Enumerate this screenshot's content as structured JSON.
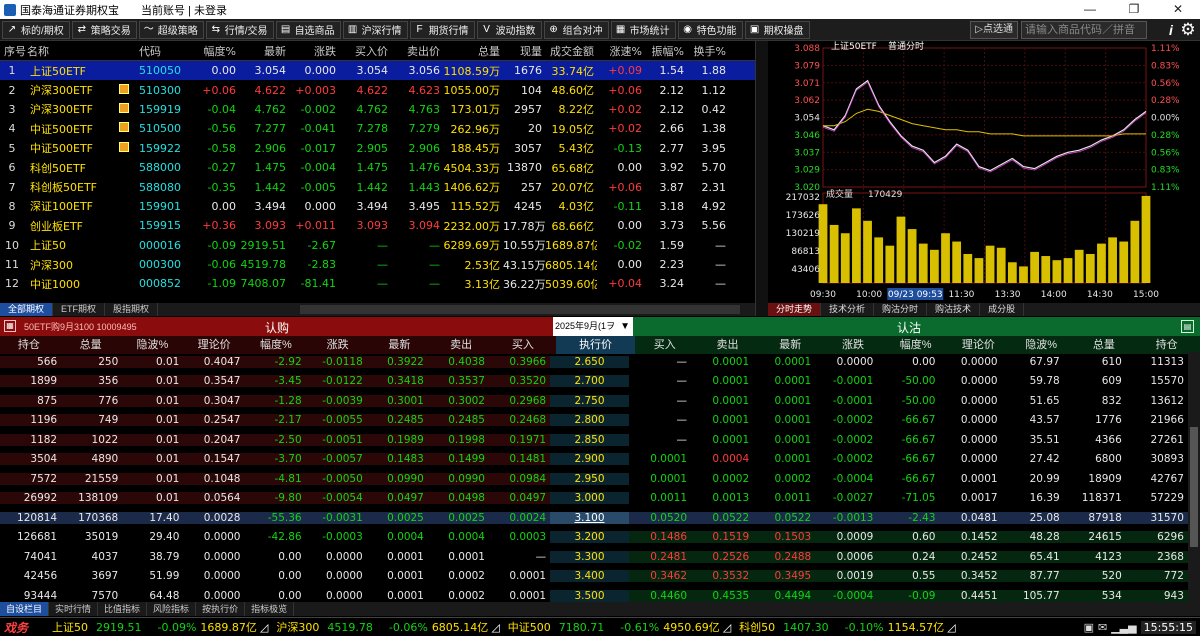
{
  "window": {
    "title": "国泰海通证券期权宝",
    "account": "当前账号 | 未登录",
    "min": "—",
    "max": "❐",
    "close": "✕"
  },
  "toolbar": {
    "buttons": [
      {
        "icon": "↗",
        "label": "标的/期权"
      },
      {
        "icon": "⇄",
        "label": "策略交易"
      },
      {
        "icon": "〜",
        "label": "超级策略"
      },
      {
        "icon": "⇆",
        "label": "行情/交易"
      },
      {
        "icon": "▤",
        "label": "自选商品"
      },
      {
        "icon": "▥",
        "label": "沪深行情"
      },
      {
        "icon": "F",
        "label": "期货行情"
      },
      {
        "icon": "V",
        "label": "波动指数"
      },
      {
        "icon": "⊕",
        "label": "组合对冲"
      },
      {
        "icon": "▦",
        "label": "市场统计"
      },
      {
        "icon": "◉",
        "label": "特色功能"
      },
      {
        "icon": "▣",
        "label": "期权操盘"
      }
    ],
    "send": "▷点选通",
    "search_placeholder": "请输入商品代码／拼音"
  },
  "quote": {
    "headers": [
      "序号",
      "名称",
      "",
      "代码",
      "幅度%",
      "最新",
      "涨跌",
      "买入价",
      "卖出价",
      "总量",
      "现量",
      "成交金额",
      "涨速%",
      "振幅%",
      "换手%"
    ],
    "rows": [
      [
        "1",
        "上证50ETF",
        "",
        "510050",
        "0.00",
        "3.054",
        "0.000",
        "3.054",
        "3.056",
        "1108.59万",
        "1676",
        "33.74亿",
        "+0.09",
        "1.54",
        "1.88"
      ],
      [
        "2",
        "沪深300ETF",
        "flag",
        "510300",
        "+0.06",
        "4.622",
        "+0.003",
        "4.622",
        "4.623",
        "1055.00万",
        "104",
        "48.60亿",
        "+0.06",
        "2.12",
        "1.12"
      ],
      [
        "3",
        "沪深300ETF",
        "flag",
        "159919",
        "-0.04",
        "4.762",
        "-0.002",
        "4.762",
        "4.763",
        "173.01万",
        "2957",
        "8.22亿",
        "+0.02",
        "2.12",
        "0.42"
      ],
      [
        "4",
        "中证500ETF",
        "flag",
        "510500",
        "-0.56",
        "7.277",
        "-0.041",
        "7.278",
        "7.279",
        "262.96万",
        "20",
        "19.05亿",
        "+0.02",
        "2.66",
        "1.38"
      ],
      [
        "5",
        "中证500ETF",
        "flag",
        "159922",
        "-0.58",
        "2.906",
        "-0.017",
        "2.905",
        "2.906",
        "188.45万",
        "3057",
        "5.43亿",
        "-0.13",
        "2.77",
        "3.95"
      ],
      [
        "6",
        "科创50ETF",
        "",
        "588000",
        "-0.27",
        "1.475",
        "-0.004",
        "1.475",
        "1.476",
        "4504.33万",
        "13870",
        "65.68亿",
        "0.00",
        "3.92",
        "5.70"
      ],
      [
        "7",
        "科创板50ETF",
        "",
        "588080",
        "-0.35",
        "1.442",
        "-0.005",
        "1.442",
        "1.443",
        "1406.62万",
        "257",
        "20.07亿",
        "+0.06",
        "3.87",
        "2.31"
      ],
      [
        "8",
        "深证100ETF",
        "",
        "159901",
        "0.00",
        "3.494",
        "0.000",
        "3.494",
        "3.495",
        "115.52万",
        "4245",
        "4.03亿",
        "-0.11",
        "3.18",
        "4.92"
      ],
      [
        "9",
        "创业板ETF",
        "",
        "159915",
        "+0.36",
        "3.093",
        "+0.011",
        "3.093",
        "3.094",
        "2232.00万",
        "17.78万",
        "68.66亿",
        "0.00",
        "3.73",
        "5.56"
      ],
      [
        "10",
        "上证50",
        "",
        "000016",
        "-0.09",
        "2919.51",
        "-2.67",
        "—",
        "—",
        "6289.69万",
        "10.55万",
        "1689.87亿",
        "-0.02",
        "1.59",
        "—"
      ],
      [
        "11",
        "沪深300",
        "",
        "000300",
        "-0.06",
        "4519.78",
        "-2.83",
        "—",
        "—",
        "2.53亿",
        "43.15万",
        "6805.14亿",
        "0.00",
        "2.23",
        "—"
      ],
      [
        "12",
        "中证1000",
        "",
        "000852",
        "-1.09",
        "7408.07",
        "-81.41",
        "—",
        "—",
        "3.13亿",
        "36.22万",
        "5039.60亿",
        "+0.04",
        "3.24",
        "—"
      ]
    ]
  },
  "quote_tabs": [
    "全部期权",
    "ETF期权",
    "股指期权"
  ],
  "chart": {
    "title": "上证50ETF",
    "mode": "普通分时",
    "y_labels": [
      "3.088",
      "3.079",
      "3.071",
      "3.062",
      "3.054",
      "3.046",
      "3.037",
      "3.029",
      "3.020"
    ],
    "pct_labels": [
      "1.11%",
      "0.83%",
      "0.56%",
      "0.28%",
      "0.00%",
      "0.28%",
      "0.56%",
      "0.83%",
      "1.11%"
    ],
    "vol_label": "成交量",
    "vol_value": "170429",
    "vol_y": [
      "217032",
      "173626",
      "130219",
      "86813",
      "43406"
    ],
    "x_labels": [
      "09:30",
      "10:00",
      "09/23 09:53",
      "11:30",
      "13:30",
      "14:00",
      "14:30",
      "15:00"
    ],
    "tabs": [
      "分时走势",
      "技术分析",
      "购沽分时",
      "购沽技术",
      "成分股"
    ],
    "chart_data": {
      "type": "line",
      "series": [
        {
          "values": [
            3.05,
            3.048,
            3.055,
            3.068,
            3.072,
            3.06,
            3.052,
            3.045,
            3.04,
            3.038,
            3.032,
            3.035,
            3.041,
            3.038,
            3.03,
            3.028,
            3.031,
            3.034,
            3.03,
            3.029,
            3.032,
            3.035,
            3.037,
            3.038,
            3.04,
            3.043,
            3.045,
            3.048,
            3.053,
            3.057
          ]
        },
        {
          "values": [
            3.05,
            3.05,
            3.052,
            3.056,
            3.058,
            3.057,
            3.055,
            3.053,
            3.051,
            3.05,
            3.049,
            3.048,
            3.048,
            3.047,
            3.047,
            3.046,
            3.046,
            3.046,
            3.045,
            3.045,
            3.045,
            3.045,
            3.045,
            3.045,
            3.045,
            3.045,
            3.045,
            3.046,
            3.046,
            3.046
          ]
        }
      ],
      "volume": [
        190000,
        140000,
        120000,
        180000,
        150000,
        110000,
        90000,
        160000,
        130000,
        95000,
        80000,
        120000,
        100000,
        70000,
        60000,
        90000,
        85000,
        50000,
        40000,
        75000,
        65000,
        55000,
        60000,
        80000,
        70000,
        95000,
        110000,
        100000,
        150000,
        210000
      ],
      "ylim": [
        3.02,
        3.088
      ]
    }
  },
  "option_bar": {
    "call_label": "认购",
    "put_label": "认沽",
    "contract": "50ETF购9月3100 10009495",
    "month": "2025年9月(1ヲ"
  },
  "option_headers": {
    "call": [
      "持仓",
      "总量",
      "隐波%",
      "理论价",
      "幅度%",
      "涨跌",
      "最新",
      "卖出",
      "买入"
    ],
    "strike": "执行价",
    "put": [
      "买入",
      "卖出",
      "最新",
      "涨跌",
      "幅度%",
      "理论价",
      "隐波%",
      "总量",
      "持仓"
    ]
  },
  "option_rows": [
    {
      "c": [
        "566",
        "250",
        "0.01",
        "0.4047",
        "-2.92",
        "-0.0118",
        "0.3922",
        "0.4038",
        "0.3966"
      ],
      "k": "2.650",
      "p": [
        "—",
        "0.0001",
        "0.0001",
        "0.0000",
        "0.00",
        "0.0000",
        "67.97",
        "610",
        "11313"
      ]
    },
    {
      "c": [
        "1899",
        "356",
        "0.01",
        "0.3547",
        "-3.45",
        "-0.0122",
        "0.3418",
        "0.3537",
        "0.3520"
      ],
      "k": "2.700",
      "p": [
        "—",
        "0.0001",
        "0.0001",
        "-0.0001",
        "-50.00",
        "0.0000",
        "59.78",
        "609",
        "15570"
      ]
    },
    {
      "c": [
        "875",
        "776",
        "0.01",
        "0.3047",
        "-1.28",
        "-0.0039",
        "0.3001",
        "0.3002",
        "0.2968"
      ],
      "k": "2.750",
      "p": [
        "—",
        "0.0001",
        "0.0001",
        "-0.0001",
        "-50.00",
        "0.0000",
        "51.65",
        "832",
        "13612"
      ]
    },
    {
      "c": [
        "1196",
        "749",
        "0.01",
        "0.2547",
        "-2.17",
        "-0.0055",
        "0.2485",
        "0.2485",
        "0.2468"
      ],
      "k": "2.800",
      "p": [
        "—",
        "0.0001",
        "0.0001",
        "-0.0002",
        "-66.67",
        "0.0000",
        "43.57",
        "1776",
        "21966"
      ]
    },
    {
      "c": [
        "1182",
        "1022",
        "0.01",
        "0.2047",
        "-2.50",
        "-0.0051",
        "0.1989",
        "0.1998",
        "0.1971"
      ],
      "k": "2.850",
      "p": [
        "—",
        "0.0001",
        "0.0001",
        "-0.0002",
        "-66.67",
        "0.0000",
        "35.51",
        "4366",
        "27261"
      ]
    },
    {
      "c": [
        "3504",
        "4890",
        "0.01",
        "0.1547",
        "-3.70",
        "-0.0057",
        "0.1483",
        "0.1499",
        "0.1481"
      ],
      "k": "2.900",
      "p": [
        "0.0001",
        "0.0004",
        "0.0001",
        "-0.0002",
        "-66.67",
        "0.0000",
        "27.42",
        "6800",
        "30893"
      ]
    },
    {
      "c": [
        "7572",
        "21559",
        "0.01",
        "0.1048",
        "-4.81",
        "-0.0050",
        "0.0990",
        "0.0990",
        "0.0984"
      ],
      "k": "2.950",
      "p": [
        "0.0001",
        "0.0002",
        "0.0002",
        "-0.0004",
        "-66.67",
        "0.0001",
        "20.99",
        "18909",
        "42767"
      ]
    },
    {
      "c": [
        "26992",
        "138109",
        "0.01",
        "0.0564",
        "-9.80",
        "-0.0054",
        "0.0497",
        "0.0498",
        "0.0497"
      ],
      "k": "3.000",
      "p": [
        "0.0011",
        "0.0013",
        "0.0011",
        "-0.0027",
        "-71.05",
        "0.0017",
        "16.39",
        "118371",
        "57229"
      ]
    },
    {
      "c": [
        "120814",
        "170368",
        "17.40",
        "0.0028",
        "-55.36",
        "-0.0031",
        "0.0025",
        "0.0025",
        "0.0024"
      ],
      "k": "3.100",
      "p": [
        "0.0520",
        "0.0522",
        "0.0522",
        "-0.0013",
        "-2.43",
        "0.0481",
        "25.08",
        "87918",
        "31570"
      ]
    },
    {
      "c": [
        "126681",
        "35019",
        "29.40",
        "0.0000",
        "-42.86",
        "-0.0003",
        "0.0004",
        "0.0004",
        "0.0003"
      ],
      "k": "3.200",
      "p": [
        "0.1486",
        "0.1519",
        "0.1503",
        "0.0009",
        "0.60",
        "0.1452",
        "48.28",
        "24615",
        "6296"
      ]
    },
    {
      "c": [
        "74041",
        "4037",
        "38.79",
        "0.0000",
        "0.00",
        "0.0000",
        "0.0001",
        "0.0001",
        "—"
      ],
      "k": "3.300",
      "p": [
        "0.2481",
        "0.2526",
        "0.2488",
        "0.0006",
        "0.24",
        "0.2452",
        "65.41",
        "4123",
        "2368"
      ]
    },
    {
      "c": [
        "42456",
        "3697",
        "51.99",
        "0.0000",
        "0.00",
        "0.0000",
        "0.0001",
        "0.0002",
        "0.0001"
      ],
      "k": "3.400",
      "p": [
        "0.3462",
        "0.3532",
        "0.3495",
        "0.0019",
        "0.55",
        "0.3452",
        "87.77",
        "520",
        "772"
      ]
    },
    {
      "c": [
        "93444",
        "7570",
        "64.48",
        "0.0000",
        "0.00",
        "0.0000",
        "0.0001",
        "0.0002",
        "0.0001"
      ],
      "k": "3.500",
      "p": [
        "0.4460",
        "0.4535",
        "0.4494",
        "-0.0004",
        "-0.09",
        "0.4451",
        "105.77",
        "534",
        "943"
      ]
    }
  ],
  "bottom_tabs": [
    "自设栏目",
    "实时行情",
    "比值指标",
    "风险指标",
    "按执行价",
    "指标极览"
  ],
  "status": {
    "logo": "戏务",
    "items": [
      {
        "name": "上证50",
        "price": "2919.51",
        "chg": "-0.09%",
        "amt": "1689.87亿"
      },
      {
        "name": "沪深300",
        "price": "4519.78",
        "chg": "-0.06%",
        "amt": "6805.14亿"
      },
      {
        "name": "中证500",
        "price": "7180.71",
        "chg": "-0.61%",
        "amt": "4950.69亿"
      },
      {
        "name": "科创50",
        "price": "1407.30",
        "chg": "-0.10%",
        "amt": "1154.57亿"
      }
    ],
    "time": "15:55:15"
  },
  "colors": {
    "up": "#ff3b3b",
    "down": "#11d511",
    "call_bar": "#8a0c0c",
    "put_bar": "#0b6a2e",
    "selected": "#0a1d9e"
  }
}
